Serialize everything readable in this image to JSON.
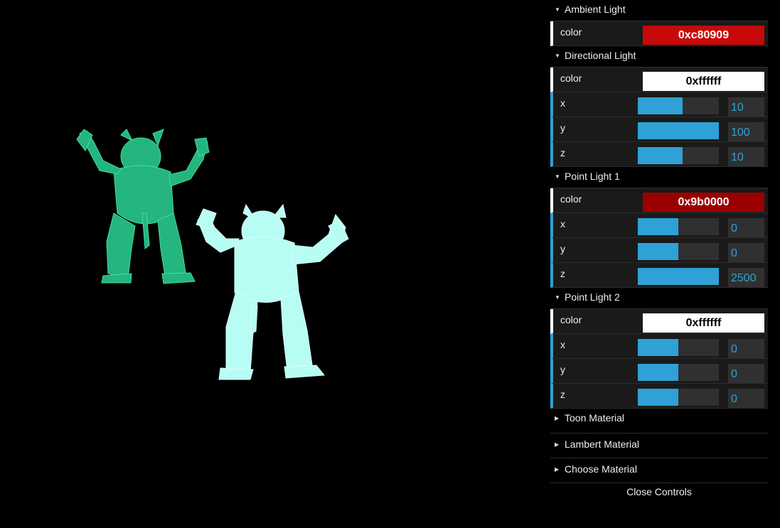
{
  "gui": {
    "ambient": {
      "title": "Ambient Light",
      "color_label": "color",
      "color_value": "0xc80909",
      "color_hex": "#c80909",
      "text_color": "#ffffff"
    },
    "directional": {
      "title": "Directional Light",
      "color_label": "color",
      "color_value": "0xffffff",
      "color_hex": "#ffffff",
      "text_color": "#000000",
      "params": [
        {
          "label": "x",
          "value": "10",
          "fraction": 0.55
        },
        {
          "label": "y",
          "value": "100",
          "fraction": 1.0
        },
        {
          "label": "z",
          "value": "10",
          "fraction": 0.55
        }
      ]
    },
    "point1": {
      "title": "Point Light 1",
      "color_label": "color",
      "color_value": "0x9b0000",
      "color_hex": "#9b0000",
      "text_color": "#ffffff",
      "params": [
        {
          "label": "x",
          "value": "0",
          "fraction": 0.5
        },
        {
          "label": "y",
          "value": "0",
          "fraction": 0.5
        },
        {
          "label": "z",
          "value": "2500",
          "fraction": 1.0
        }
      ]
    },
    "point2": {
      "title": "Point Light 2",
      "color_label": "color",
      "color_value": "0xffffff",
      "color_hex": "#ffffff",
      "text_color": "#000000",
      "params": [
        {
          "label": "x",
          "value": "0",
          "fraction": 0.5
        },
        {
          "label": "y",
          "value": "0",
          "fraction": 0.5
        },
        {
          "label": "z",
          "value": "0",
          "fraction": 0.5
        }
      ]
    },
    "closed_folders": [
      "Toon Material",
      "Lambert Material",
      "Choose Material"
    ],
    "close_label": "Close Controls"
  },
  "scene": {
    "background": "#000000",
    "model_left_color": "#2fcf8f",
    "model_right_color": "#b8fdf4"
  }
}
